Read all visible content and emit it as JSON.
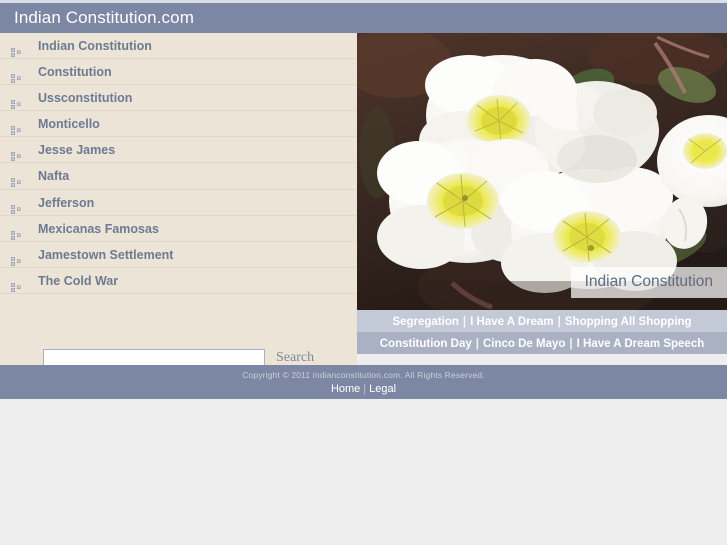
{
  "header": {
    "title": "Indian Constitution.com"
  },
  "sidebar": {
    "items": [
      {
        "label": "Indian Constitution",
        "icon": "squares-bullet-icon"
      },
      {
        "label": "Constitution",
        "icon": "squares-bullet-icon"
      },
      {
        "label": "Ussconstitution",
        "icon": "squares-bullet-icon"
      },
      {
        "label": "Monticello",
        "icon": "squares-bullet-icon"
      },
      {
        "label": "Jesse James",
        "icon": "squares-bullet-icon"
      },
      {
        "label": "Nafta",
        "icon": "squares-bullet-icon"
      },
      {
        "label": "Jefferson",
        "icon": "squares-bullet-icon"
      },
      {
        "label": "Mexicanas Famosas",
        "icon": "squares-bullet-icon"
      },
      {
        "label": "Jamestown Settlement",
        "icon": "squares-bullet-icon"
      },
      {
        "label": "The Cold War",
        "icon": "squares-bullet-icon"
      }
    ]
  },
  "search": {
    "value": "",
    "placeholder": "",
    "button_label": "Search"
  },
  "hero": {
    "caption": "Indian Constitution",
    "alt": "White evening primrose flowers with yellow centers"
  },
  "bottom_nav": {
    "separator": "|",
    "row1": [
      "Segregation",
      "I Have A Dream",
      "Shopping All Shopping"
    ],
    "row2": [
      "Constitution Day",
      "Cinco De Mayo",
      "I Have A Dream Speech"
    ]
  },
  "footer": {
    "copyright": "Copyright © 2011 indianconstitution.com. All Rights Reserved.",
    "links": [
      "Home",
      "Legal"
    ],
    "separator": "|"
  },
  "colors": {
    "header_bg": "#7b87a3",
    "sidebar_bg": "#ece5d7",
    "nav_row1_bg": "#c3c9d6",
    "nav_row2_bg": "#a9b1c3",
    "link_text": "#6d7a91",
    "page_bg": "#eeeeee"
  }
}
